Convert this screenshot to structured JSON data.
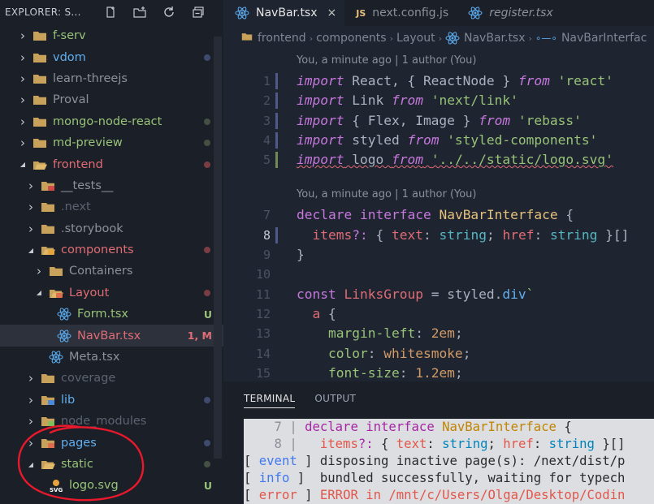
{
  "explorer": {
    "title": "EXPLORER: S...",
    "actions": [
      "new-file-icon",
      "new-folder-icon",
      "refresh-icon",
      "collapse-icon"
    ],
    "items": [
      {
        "label": "f-serv",
        "depth": 0,
        "expanded": false,
        "kind": "folder",
        "color": "#98c379",
        "dot": ""
      },
      {
        "label": "vdom",
        "depth": 0,
        "expanded": false,
        "kind": "folder",
        "color": "#61afef",
        "dot": "#3e4b6e"
      },
      {
        "label": "learn-threejs",
        "depth": 0,
        "expanded": false,
        "kind": "folder",
        "color": "#8b919c",
        "dot": ""
      },
      {
        "label": "Proval",
        "depth": 0,
        "expanded": false,
        "kind": "folder",
        "color": "#8b919c",
        "dot": ""
      },
      {
        "label": "mongo-node-react",
        "depth": 0,
        "expanded": false,
        "kind": "folder",
        "color": "#98c379",
        "dot": "#445042"
      },
      {
        "label": "md-preview",
        "depth": 0,
        "expanded": false,
        "kind": "folder",
        "color": "#98c379",
        "dot": "#445042"
      },
      {
        "label": "frontend",
        "depth": 0,
        "expanded": true,
        "kind": "folder",
        "color": "#e06c75",
        "dot": "#7a3d44"
      },
      {
        "label": "__tests__",
        "depth": 1,
        "expanded": false,
        "kind": "folder-test",
        "color": "#8b919c",
        "dot": ""
      },
      {
        "label": ".next",
        "depth": 1,
        "expanded": false,
        "kind": "folder",
        "color": "#5c6370",
        "dot": ""
      },
      {
        "label": ".storybook",
        "depth": 1,
        "expanded": false,
        "kind": "folder",
        "color": "#8b919c",
        "dot": ""
      },
      {
        "label": "components",
        "depth": 1,
        "expanded": true,
        "kind": "folder-components",
        "color": "#e06c75",
        "dot": "#7a3d44"
      },
      {
        "label": "Containers",
        "depth": 2,
        "expanded": false,
        "kind": "folder",
        "color": "#8b919c",
        "dot": ""
      },
      {
        "label": "Layout",
        "depth": 2,
        "expanded": true,
        "kind": "folder-layout",
        "color": "#e06c75",
        "dot": "#7a3d44"
      },
      {
        "label": "Form.tsx",
        "depth": 3,
        "kind": "file-react",
        "color": "#98c379",
        "badge": "U",
        "badge_color": "#98c379"
      },
      {
        "label": "NavBar.tsx",
        "depth": 3,
        "kind": "file-react",
        "color": "#e06c75",
        "badge": "1, M",
        "badge_color": "#e06c75",
        "selected": true
      },
      {
        "label": "Meta.tsx",
        "depth": 2,
        "kind": "file-react",
        "color": "#8b919c"
      },
      {
        "label": "coverage",
        "depth": 1,
        "expanded": false,
        "kind": "folder",
        "color": "#5c6370",
        "dot": ""
      },
      {
        "label": "lib",
        "depth": 1,
        "expanded": false,
        "kind": "folder-lib",
        "color": "#61afef",
        "dot": "#3e4b6e"
      },
      {
        "label": "node_modules",
        "depth": 1,
        "expanded": false,
        "kind": "folder-node",
        "color": "#5c6370",
        "dot": ""
      },
      {
        "label": "pages",
        "depth": 1,
        "expanded": false,
        "kind": "folder-pages",
        "color": "#61afef",
        "dot": "#3e4b6e"
      },
      {
        "label": "static",
        "depth": 1,
        "expanded": true,
        "kind": "folder",
        "color": "#98c379",
        "dot": "#445042"
      },
      {
        "label": "logo.svg",
        "depth": 2,
        "kind": "file-svg",
        "color": "#98c379",
        "badge": "U",
        "badge_color": "#98c379"
      }
    ]
  },
  "tabs": [
    {
      "label": "NavBar.tsx",
      "icon": "react-icon",
      "active": true,
      "close": "×"
    },
    {
      "label": "next.config.js",
      "icon": "js-icon",
      "active": false
    },
    {
      "label": "register.tsx",
      "icon": "react-icon",
      "active": false,
      "italic": true
    }
  ],
  "breadcrumb": [
    "frontend",
    "components",
    "Layout",
    "NavBar.tsx",
    "NavBarInterfac"
  ],
  "editor": {
    "codelens": "You, a minute ago | 1 author (You)",
    "lines": [
      {
        "n": "1",
        "html": "<span class='kw'>import</span> React, { ReactNode } <span class='kw'>from</span> <span class='str'>'react'</span>"
      },
      {
        "n": "2",
        "html": "<span class='kw'>import</span> Link <span class='kw'>from</span> <span class='str'>'next/link'</span>"
      },
      {
        "n": "3",
        "html": "<span class='kw'>import</span> { Flex, Image } <span class='kw'>from</span> <span class='str'>'rebass'</span>"
      },
      {
        "n": "4",
        "html": "<span class='kw'>import</span> styled <span class='kw'>from</span> <span class='str'>'styled-components'</span>"
      },
      {
        "n": "5",
        "html": "<span class='kw'>import</span> logo <span class='kw'>from</span> <span class='str'>'../../static/logo.svg'</span>"
      },
      {
        "n": "",
        "html": ""
      },
      {
        "lens": true
      },
      {
        "n": "7",
        "html": "<span class='kwn'>declare</span> <span class='kwn'>interface</span> <span class='typ'>NavBarInterface</span> {"
      },
      {
        "n": "8",
        "html": "  <span class='prop'>items</span><span class='kwn'>?:</span> { <span class='prop'>text</span>: <span class='cyan'>string</span>; <span class='prop'>href</span>: <span class='cyan'>string</span> }[]",
        "active": true
      },
      {
        "n": "9",
        "html": "}"
      },
      {
        "n": "10",
        "html": ""
      },
      {
        "n": "11",
        "html": "<span class='kwn'>const</span> <span class='tag'>LinksGroup</span> = styled.<span class='fn'>div</span><span class='str'>`</span>"
      },
      {
        "n": "12",
        "html": "  <span class='tag'>a</span> {"
      },
      {
        "n": "13",
        "html": "    <span class='str'>margin-left</span>: <span class='num'>2em</span>;"
      },
      {
        "n": "14",
        "html": "    <span class='str'>color</span>: <span class='num'>whitesmoke</span>;"
      },
      {
        "n": "15",
        "html": "    <span class='str'>font-size</span>: <span class='num'>1.2em</span>;"
      }
    ]
  },
  "panel": {
    "tabs": [
      "TERMINAL",
      "OUTPUT"
    ],
    "lines": [
      {
        "html": "<span class='t-gray'>    7 |</span> <span class='t-kw'>declare</span> <span class='t-kw'>interface</span> <span class='t-type'>NavBarInterface</span> {"
      },
      {
        "html": "<span class='t-gray'>    8 |</span>   <span class='t-red'>items</span><span class='t-kw'>?:</span> { <span class='t-red'>text</span>: <span class='t-cyan'>string</span>; <span class='t-red'>href</span>: <span class='t-cyan'>string</span> }[]"
      },
      {
        "html": "[ <span class='t-blue'>event</span> ] disposing inactive page(s): /next/dist/p"
      },
      {
        "html": "[ <span class='t-blue'>info</span> ]  bundled successfully, waiting for typech"
      },
      {
        "html": "[ <span class='t-red'>error</span> ] <span class='t-red'>ERROR in /mnt/c/Users/Olga/Desktop/Codin</span>"
      }
    ]
  }
}
